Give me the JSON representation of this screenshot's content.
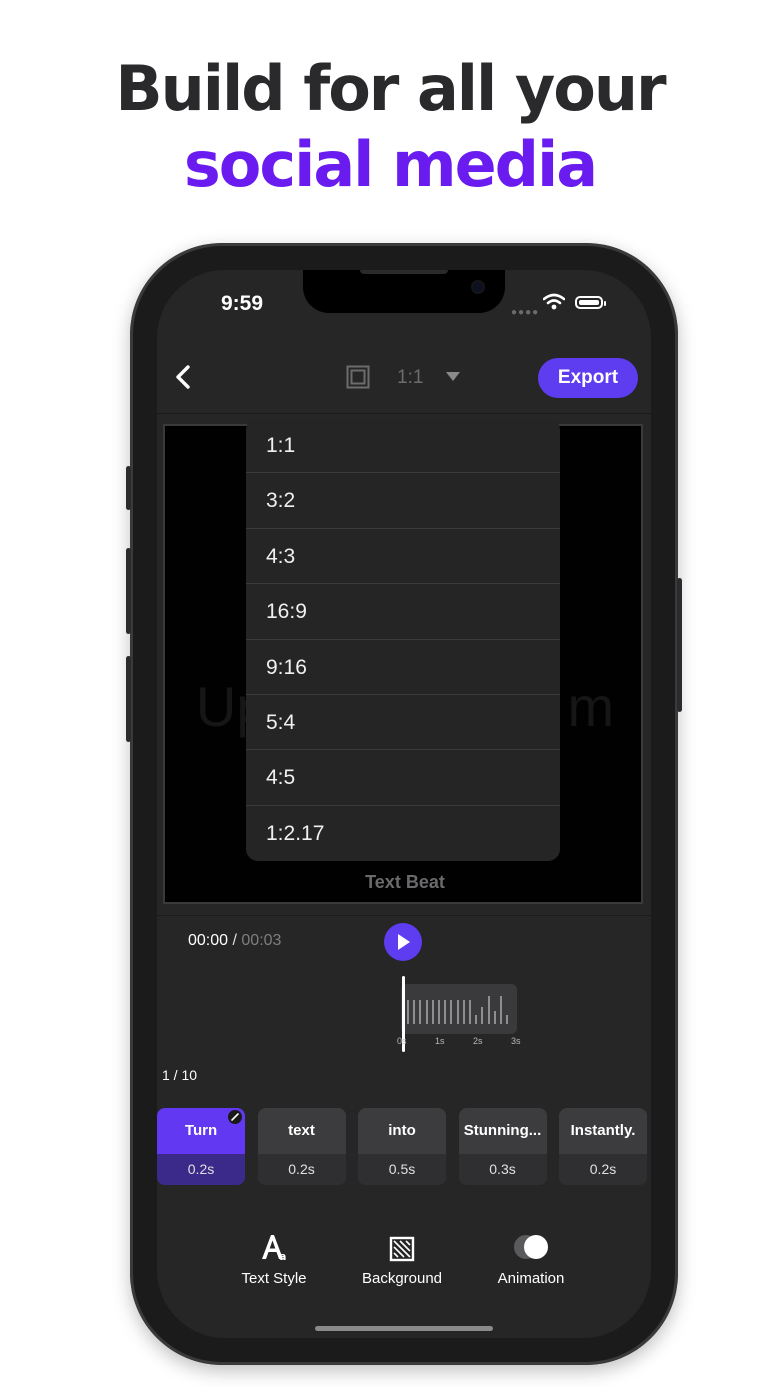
{
  "headline": {
    "line1": "Build for all your",
    "line2": "social media"
  },
  "status": {
    "time": "9:59"
  },
  "toolbar": {
    "ratio": "1:1",
    "export_label": "Export"
  },
  "dropdown": {
    "options": [
      "1:1",
      "3:2",
      "4:3",
      "16:9",
      "9:16",
      "5:4",
      "4:5",
      "1:2.17"
    ]
  },
  "canvas": {
    "watermark": "Up",
    "watermark_end": "m",
    "brand": "Text Beat"
  },
  "player": {
    "current": "00:00",
    "separator": "/",
    "duration": "00:03"
  },
  "timeline": {
    "ticks": [
      "0s",
      "1s",
      "2s",
      "3s"
    ],
    "waveform": [
      0.55,
      0.55,
      0.55,
      0.55,
      0.55,
      0.55,
      0.55,
      0.55,
      0.55,
      0.55,
      0.55,
      0.2,
      0.4,
      0.65,
      0.3,
      0.65,
      0.2
    ]
  },
  "words": {
    "counter": "1 / 10",
    "items": [
      {
        "word": "Turn",
        "duration": "0.2s"
      },
      {
        "word": "text",
        "duration": "0.2s"
      },
      {
        "word": "into",
        "duration": "0.5s"
      },
      {
        "word": "Stunning...",
        "duration": "0.3s"
      },
      {
        "word": "Instantly.",
        "duration": "0.2s"
      }
    ]
  },
  "tools": {
    "text_style": "Text Style",
    "background": "Background",
    "animation": "Animation"
  },
  "colors": {
    "accent": "#5e3cf0",
    "headline_accent": "#6a1cf0",
    "screen_bg": "#262627"
  }
}
